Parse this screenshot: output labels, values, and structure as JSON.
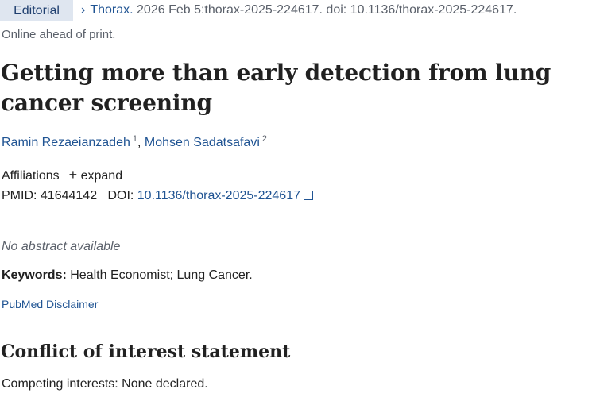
{
  "article": {
    "type_badge": "Editorial",
    "journal": "Thorax.",
    "citation": " 2026 Feb 5:thorax-2025-224617. doi: 10.1136/thorax-2025-224617.",
    "online_status": "Online ahead of print.",
    "title": "Getting more than early detection from lung cancer screening",
    "authors": [
      {
        "name": "Ramin Rezaeianzadeh",
        "affil": "1"
      },
      {
        "name": "Mohsen Sadatsafavi",
        "affil": "2"
      }
    ],
    "author_separator": ",",
    "affiliations_label": "Affiliations",
    "expand_label": "expand",
    "pmid_label": "PMID:",
    "pmid": "41644142",
    "doi_label": "DOI:",
    "doi": "10.1136/thorax-2025-224617",
    "no_abstract": "No abstract available",
    "keywords_label": "Keywords:",
    "keywords": " Health Economist; Lung Cancer.",
    "disclaimer": "PubMed Disclaimer",
    "coi_heading": "Conflict of interest statement",
    "competing_interests": "Competing interests: None declared."
  },
  "icons": {
    "chevron": "chevron-right-icon",
    "plus": "plus-icon",
    "external": "external-link-icon"
  },
  "colors": {
    "link": "#205493",
    "badge_bg": "#dfe6f0",
    "text": "#212121",
    "muted": "#5b616b"
  }
}
